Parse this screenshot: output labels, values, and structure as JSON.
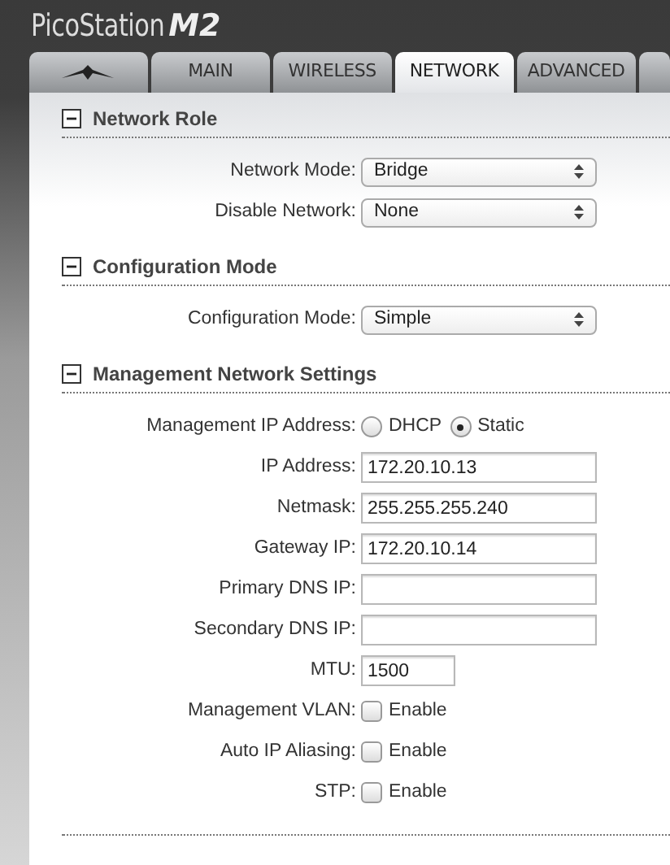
{
  "header": {
    "product": "PicoStation",
    "model": "M2"
  },
  "tabs": [
    {
      "kind": "logo",
      "selected": false
    },
    {
      "kind": "text",
      "label": "MAIN",
      "selected": false
    },
    {
      "kind": "text",
      "label": "WIRELESS",
      "selected": false
    },
    {
      "kind": "text",
      "label": "NETWORK",
      "selected": true
    },
    {
      "kind": "text",
      "label": "ADVANCED",
      "selected": false
    },
    {
      "kind": "stub",
      "selected": false
    }
  ],
  "sections": [
    {
      "title": "Network Role",
      "expanded": true,
      "rows": [
        {
          "kind": "select",
          "label": "Network Mode:",
          "value": "Bridge"
        },
        {
          "kind": "select",
          "label": "Disable Network:",
          "value": "None"
        }
      ]
    },
    {
      "title": "Configuration Mode",
      "expanded": true,
      "rows": [
        {
          "kind": "select",
          "label": "Configuration Mode:",
          "value": "Simple"
        }
      ]
    },
    {
      "title": "Management Network Settings",
      "expanded": true,
      "rows": [
        {
          "kind": "radio",
          "label": "Management IP Address:",
          "options": [
            {
              "label": "DHCP",
              "selected": false
            },
            {
              "label": "Static",
              "selected": true
            }
          ]
        },
        {
          "kind": "text",
          "label": "IP Address:",
          "value": "172.20.10.13"
        },
        {
          "kind": "text",
          "label": "Netmask:",
          "value": "255.255.255.240"
        },
        {
          "kind": "text",
          "label": "Gateway IP:",
          "value": "172.20.10.14"
        },
        {
          "kind": "text",
          "label": "Primary DNS IP:",
          "value": ""
        },
        {
          "kind": "text",
          "label": "Secondary DNS IP:",
          "value": ""
        },
        {
          "kind": "short",
          "label": "MTU:",
          "value": "1500"
        },
        {
          "kind": "checkbox",
          "label": "Management VLAN:",
          "option": "Enable",
          "checked": false
        },
        {
          "kind": "checkbox",
          "label": "Auto IP Aliasing:",
          "option": "Enable",
          "checked": false
        },
        {
          "kind": "checkbox",
          "label": "STP:",
          "option": "Enable",
          "checked": false
        }
      ]
    }
  ]
}
